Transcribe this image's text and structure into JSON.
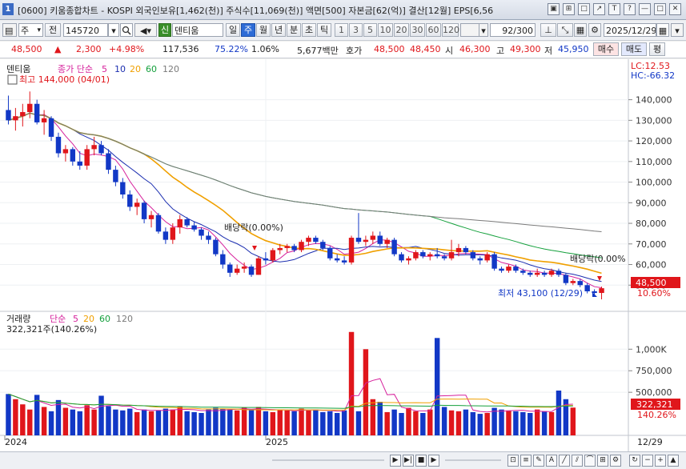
{
  "window": {
    "number": "1",
    "title": "[0600] 키움종합차트 - KOSPI 외국인보유[1,462(천)] 주식수[11,069(천)] 액면[500] 자본금[62(억)] 결산[12월] EPS[6,56",
    "controls": [
      "▣",
      "⊞",
      "□",
      "↗",
      "T",
      "?",
      "—",
      "□",
      "✕"
    ]
  },
  "toolbar": {
    "market": "주",
    "market_arrow": "▾",
    "prev": "전",
    "code": "145720",
    "search_icon": "search-icon",
    "sound_icon": "sound-icon",
    "new_badge": "신",
    "stock_name": "덴티움",
    "periods": [
      "일",
      "주",
      "월",
      "년",
      "분",
      "초",
      "틱"
    ],
    "period_selected": "주",
    "intervals": [
      "1",
      "3",
      "5",
      "10",
      "20",
      "30",
      "60",
      "120"
    ],
    "page_counter": "92/300",
    "date": "2025/12/29"
  },
  "quote": {
    "price": "48,500",
    "change_arrow": "▲",
    "change": "2,300",
    "change_pct": "+4.98%",
    "volume": "117,536",
    "turnover_pct": "75.22%",
    "pct2": "1.06%",
    "amount": "5,677백만",
    "bid_ask_label": "호가",
    "ask": "48,500",
    "bid": "48,450",
    "open_label": "시",
    "open": "46,300",
    "high_label": "고",
    "high": "49,300",
    "low_label": "저",
    "low": "45,950",
    "buy_button": "매수",
    "sell_button": "매도",
    "eval_button": "평"
  },
  "price_panel": {
    "legend_name": "덴티움",
    "legend_ma_label": "종가 단순",
    "legend_periods": [
      "5",
      "10",
      "20",
      "60",
      "120"
    ],
    "max_label": "최고 144,000 (04/01)",
    "min_label": "최저 43,100 (12/29)",
    "dividend_labels": [
      "배당락(0.00%)",
      "배당락(0.00%"
    ],
    "lc_label": "LC:12.53",
    "hc_label": "HC:-66.32",
    "current_price_tag": "48,500",
    "current_pct_tag": "10.60%",
    "y_ticks": [
      "140,000",
      "130,000",
      "120,000",
      "110,000",
      "100,000",
      "90,000",
      "80,000",
      "70,000",
      "60,000",
      "50,000"
    ]
  },
  "volume_panel": {
    "legend_name": "거래량",
    "legend_ma_label": "단순",
    "legend_periods": [
      "5",
      "20",
      "60",
      "120"
    ],
    "current_volume": "322,321주(140.26%)",
    "y_ticks": [
      "1,000K",
      "750,000",
      "500,000"
    ],
    "current_tag": "322,321",
    "current_pct_tag": "140.26%"
  },
  "x_axis": {
    "labels": [
      "2024",
      "2025"
    ],
    "right_label": "12/29"
  },
  "colors": {
    "up": "#e0161b",
    "down": "#1238c6",
    "ma5": "#d6219c",
    "ma10": "#1c2fb0",
    "ma20": "#f0a000",
    "ma60": "#14a03c",
    "ma120": "#7a7a7a"
  },
  "chart_data": {
    "type": "candlestick",
    "title": "덴티움",
    "period": "weekly",
    "ylim": [
      40000,
      148000
    ],
    "candles": [
      [
        135000,
        142000,
        128000,
        130000
      ],
      [
        130000,
        136000,
        125000,
        132000
      ],
      [
        132000,
        138000,
        127000,
        134000
      ],
      [
        134000,
        144000,
        131000,
        138000
      ],
      [
        138000,
        140000,
        128000,
        129000
      ],
      [
        129000,
        135000,
        123000,
        131000
      ],
      [
        131000,
        132000,
        120000,
        122000
      ],
      [
        122000,
        124000,
        112000,
        114000
      ],
      [
        114000,
        118000,
        110000,
        116000
      ],
      [
        116000,
        117000,
        108000,
        110000
      ],
      [
        110000,
        115000,
        106000,
        108000
      ],
      [
        108000,
        118000,
        106000,
        116000
      ],
      [
        116000,
        122000,
        113000,
        118000
      ],
      [
        118000,
        120000,
        113000,
        114000
      ],
      [
        114000,
        116000,
        104000,
        106000
      ],
      [
        106000,
        108000,
        98000,
        100000
      ],
      [
        100000,
        102000,
        92000,
        94000
      ],
      [
        94000,
        96000,
        86000,
        88000
      ],
      [
        88000,
        92000,
        84000,
        90000
      ],
      [
        90000,
        91000,
        80000,
        82000
      ],
      [
        82000,
        86000,
        78000,
        84000
      ],
      [
        84000,
        85000,
        75000,
        76000
      ],
      [
        76000,
        78000,
        70000,
        72000
      ],
      [
        72000,
        80000,
        70000,
        78000
      ],
      [
        78000,
        84000,
        75000,
        82000
      ],
      [
        82000,
        83000,
        78000,
        79000
      ],
      [
        79000,
        81000,
        76000,
        77000
      ],
      [
        77000,
        78000,
        72000,
        74000
      ],
      [
        74000,
        76000,
        70000,
        72000
      ],
      [
        72000,
        73000,
        64000,
        65000
      ],
      [
        65000,
        67000,
        58000,
        60000
      ],
      [
        60000,
        61000,
        54000,
        56000
      ],
      [
        56000,
        60000,
        55000,
        58000
      ],
      [
        58000,
        61000,
        56000,
        59000
      ],
      [
        59000,
        60000,
        54000,
        55000
      ],
      [
        55000,
        64000,
        55000,
        63000
      ],
      [
        63000,
        66000,
        60000,
        62000
      ],
      [
        62000,
        68000,
        61000,
        67000
      ],
      [
        67000,
        70000,
        65000,
        68000
      ],
      [
        68000,
        70000,
        66000,
        69000
      ],
      [
        69000,
        70000,
        66000,
        67000
      ],
      [
        67000,
        72000,
        66000,
        71000
      ],
      [
        71000,
        74000,
        69000,
        73000
      ],
      [
        73000,
        74000,
        70000,
        71000
      ],
      [
        71000,
        72000,
        67000,
        68000
      ],
      [
        68000,
        69000,
        62000,
        63000
      ],
      [
        63000,
        65000,
        61000,
        62000
      ],
      [
        62000,
        64000,
        60000,
        61000
      ],
      [
        61000,
        74000,
        60000,
        73000
      ],
      [
        73000,
        85000,
        70000,
        71000
      ],
      [
        71000,
        74000,
        69000,
        72000
      ],
      [
        72000,
        76000,
        70000,
        74000
      ],
      [
        74000,
        76000,
        69000,
        70000
      ],
      [
        70000,
        73000,
        68000,
        72000
      ],
      [
        72000,
        73000,
        64000,
        65000
      ],
      [
        65000,
        66000,
        61000,
        62000
      ],
      [
        62000,
        64000,
        60000,
        63000
      ],
      [
        63000,
        67000,
        62000,
        66000
      ],
      [
        66000,
        67000,
        63000,
        64000
      ],
      [
        64000,
        66000,
        62000,
        65000
      ],
      [
        65000,
        68000,
        63000,
        64000
      ],
      [
        64000,
        65000,
        62000,
        63000
      ],
      [
        63000,
        72000,
        62000,
        66000
      ],
      [
        66000,
        70000,
        64000,
        68000
      ],
      [
        68000,
        69000,
        65000,
        66000
      ],
      [
        66000,
        67000,
        62000,
        63000
      ],
      [
        63000,
        64000,
        60000,
        62000
      ],
      [
        62000,
        66000,
        61000,
        65000
      ],
      [
        65000,
        66000,
        57000,
        58000
      ],
      [
        58000,
        59000,
        56000,
        57000
      ],
      [
        57000,
        60000,
        56000,
        59000
      ],
      [
        59000,
        60000,
        56000,
        57000
      ],
      [
        57000,
        58000,
        55000,
        56000
      ],
      [
        56000,
        57000,
        54000,
        55000
      ],
      [
        55000,
        58000,
        54000,
        56000
      ],
      [
        56000,
        57000,
        54000,
        55000
      ],
      [
        55000,
        58000,
        54000,
        57000
      ],
      [
        57000,
        58000,
        54000,
        55000
      ],
      [
        55000,
        56000,
        50000,
        51000
      ],
      [
        51000,
        53000,
        50000,
        52000
      ],
      [
        52000,
        53000,
        49000,
        50000
      ],
      [
        50000,
        51000,
        46000,
        47000
      ],
      [
        47000,
        48000,
        45000,
        46200
      ],
      [
        46200,
        49300,
        43100,
        48500
      ]
    ],
    "volumes": [
      480000,
      420000,
      360000,
      300000,
      470000,
      330000,
      280000,
      410000,
      320000,
      300000,
      280000,
      350000,
      300000,
      460000,
      340000,
      300000,
      290000,
      310000,
      270000,
      300000,
      280000,
      290000,
      310000,
      300000,
      330000,
      280000,
      270000,
      260000,
      300000,
      320000,
      310000,
      300000,
      290000,
      320000,
      300000,
      330000,
      280000,
      270000,
      300000,
      290000,
      280000,
      310000,
      290000,
      300000,
      270000,
      280000,
      260000,
      290000,
      1200000,
      280000,
      1000000,
      420000,
      390000,
      270000,
      300000,
      260000,
      320000,
      280000,
      260000,
      300000,
      1130000,
      330000,
      290000,
      280000,
      300000,
      270000,
      250000,
      260000,
      320000,
      300000,
      290000,
      280000,
      270000,
      260000,
      300000,
      280000,
      270000,
      520000,
      420000,
      322321
    ]
  }
}
